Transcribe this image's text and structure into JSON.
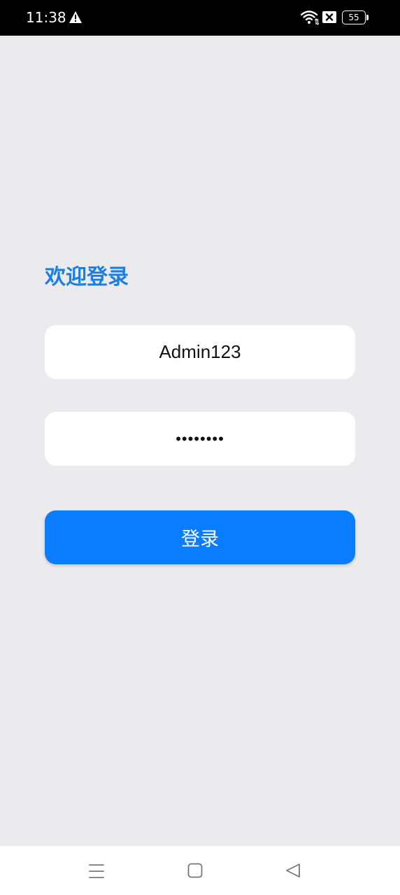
{
  "status_bar": {
    "time": "11:38",
    "battery_level": "55",
    "icons": [
      "warning-icon",
      "wifi-icon",
      "sim-icon",
      "battery-icon"
    ]
  },
  "login": {
    "title": "欢迎登录",
    "username_value": "Admin123",
    "password_value": "12345678",
    "button_label": "登录"
  },
  "nav_bar": {
    "icons": [
      "menu-icon",
      "home-icon",
      "back-icon"
    ]
  },
  "colors": {
    "background": "#ebebed",
    "title": "#1a7fe0",
    "button": "#0a7cff",
    "status_bar": "#000000"
  }
}
